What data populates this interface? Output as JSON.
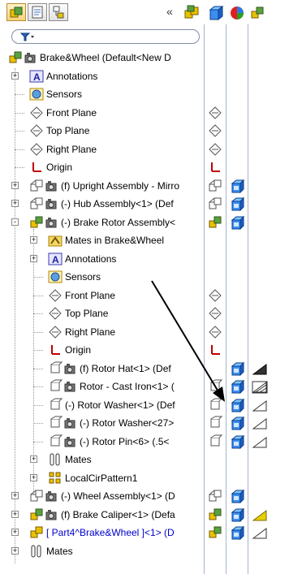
{
  "toolbar": {
    "buttons": [
      "feature-manager-tab",
      "property-manager-tab",
      "configuration-manager-tab"
    ],
    "collapse_label": "«",
    "right_icons": [
      "assembly-icon",
      "display-pane-icon",
      "appearance-icon"
    ]
  },
  "filter": {
    "icon": "filter-icon",
    "value": ""
  },
  "tree": [
    {
      "label": "Brake&Wheel  (Default<New D",
      "level": 0,
      "expander": "",
      "icons": [
        "assembly-icon",
        "camera-icon"
      ],
      "c1": "",
      "c2": "",
      "c3": ""
    },
    {
      "label": "Annotations",
      "level": 1,
      "expander": "+",
      "icons": [
        "annotations-icon"
      ],
      "c1": "",
      "c2": "",
      "c3": ""
    },
    {
      "label": "Sensors",
      "level": 1,
      "expander": "",
      "icons": [
        "sensors-icon"
      ],
      "c1": "",
      "c2": "",
      "c3": ""
    },
    {
      "label": "Front Plane",
      "level": 1,
      "expander": "",
      "icons": [
        "plane-icon"
      ],
      "c1": "plane",
      "c2": "",
      "c3": ""
    },
    {
      "label": "Top Plane",
      "level": 1,
      "expander": "",
      "icons": [
        "plane-icon"
      ],
      "c1": "plane",
      "c2": "",
      "c3": ""
    },
    {
      "label": "Right Plane",
      "level": 1,
      "expander": "",
      "icons": [
        "plane-icon"
      ],
      "c1": "plane",
      "c2": "",
      "c3": ""
    },
    {
      "label": "Origin",
      "level": 1,
      "expander": "",
      "icons": [
        "origin-icon"
      ],
      "c1": "origin",
      "c2": "",
      "c3": ""
    },
    {
      "label": "(f) Upright Assembly - Mirro",
      "level": 1,
      "expander": "+",
      "icons": [
        "subassembly-icon",
        "camera-icon"
      ],
      "c1": "asm",
      "c2": "box",
      "c3": ""
    },
    {
      "label": "(-) Hub Assembly<1> (Def",
      "level": 1,
      "expander": "+",
      "icons": [
        "subassembly-icon",
        "camera-icon"
      ],
      "c1": "asm",
      "c2": "box",
      "c3": ""
    },
    {
      "label": "(-) Brake Rotor Assembly<",
      "level": 1,
      "expander": "-",
      "icons": [
        "subassembly-color-icon",
        "camera-icon"
      ],
      "c1": "asm-color",
      "c2": "box",
      "c3": ""
    },
    {
      "label": "Mates in Brake&Wheel",
      "level": 2,
      "expander": "+",
      "icons": [
        "mates-folder-icon"
      ],
      "c1": "",
      "c2": "",
      "c3": ""
    },
    {
      "label": "Annotations",
      "level": 2,
      "expander": "+",
      "icons": [
        "annotations-icon"
      ],
      "c1": "",
      "c2": "",
      "c3": ""
    },
    {
      "label": "Sensors",
      "level": 2,
      "expander": "",
      "icons": [
        "sensors-icon"
      ],
      "c1": "",
      "c2": "",
      "c3": ""
    },
    {
      "label": "Front Plane",
      "level": 2,
      "expander": "",
      "icons": [
        "plane-icon"
      ],
      "c1": "plane",
      "c2": "",
      "c3": ""
    },
    {
      "label": "Top Plane",
      "level": 2,
      "expander": "",
      "icons": [
        "plane-icon"
      ],
      "c1": "plane",
      "c2": "",
      "c3": ""
    },
    {
      "label": "Right Plane",
      "level": 2,
      "expander": "",
      "icons": [
        "plane-icon"
      ],
      "c1": "plane",
      "c2": "",
      "c3": ""
    },
    {
      "label": "Origin",
      "level": 2,
      "expander": "",
      "icons": [
        "origin-icon"
      ],
      "c1": "origin",
      "c2": "",
      "c3": ""
    },
    {
      "label": "(f) Rotor Hat<1> (Def",
      "level": 2,
      "expander": "",
      "icons": [
        "part-icon",
        "camera-icon"
      ],
      "c1": "",
      "c2": "box",
      "c3": "filled-triangle"
    },
    {
      "label": "Rotor - Cast Iron<1> (",
      "level": 2,
      "expander": "",
      "icons": [
        "part-icon",
        "camera-icon"
      ],
      "c1": "part",
      "c2": "box",
      "c3": "hatched-triangle"
    },
    {
      "label": "(-) Rotor Washer<1> (Def",
      "level": 2,
      "expander": "",
      "icons": [
        "part-icon"
      ],
      "c1": "part",
      "c2": "box",
      "c3": "triangle"
    },
    {
      "label": "(-) Rotor Washer<27>",
      "level": 2,
      "expander": "",
      "icons": [
        "part-icon",
        "camera-icon"
      ],
      "c1": "part",
      "c2": "box",
      "c3": "triangle"
    },
    {
      "label": "(-) Rotor Pin<6> (.5<",
      "level": 2,
      "expander": "",
      "icons": [
        "part-icon",
        "camera-icon"
      ],
      "c1": "part",
      "c2": "box",
      "c3": "triangle"
    },
    {
      "label": "Mates",
      "level": 2,
      "expander": "+",
      "icons": [
        "mates-icon"
      ],
      "c1": "",
      "c2": "",
      "c3": ""
    },
    {
      "label": "LocalCirPattern1",
      "level": 2,
      "expander": "+",
      "icons": [
        "pattern-icon"
      ],
      "c1": "",
      "c2": "",
      "c3": ""
    },
    {
      "label": "(-) Wheel Assembly<1> (D",
      "level": 1,
      "expander": "+",
      "icons": [
        "subassembly-icon",
        "camera-icon"
      ],
      "c1": "asm",
      "c2": "box",
      "c3": ""
    },
    {
      "label": "(f) Brake Caliper<1> (Defa",
      "level": 1,
      "expander": "+",
      "icons": [
        "subassembly-color-icon",
        "camera-icon"
      ],
      "c1": "asm-color",
      "c2": "box",
      "c3": "yellow-triangle"
    },
    {
      "label": "[ Part4^Brake&Wheel ]<1> (D",
      "level": 1,
      "expander": "+",
      "icons": [
        "virtual-part-icon"
      ],
      "c1": "asm-color",
      "c2": "box",
      "c3": "triangle",
      "blue": true
    },
    {
      "label": "Mates",
      "level": 1,
      "expander": "+",
      "icons": [
        "mates-icon"
      ],
      "c1": "",
      "c2": "",
      "c3": ""
    }
  ],
  "annotation_arrow": "callout-arrow"
}
